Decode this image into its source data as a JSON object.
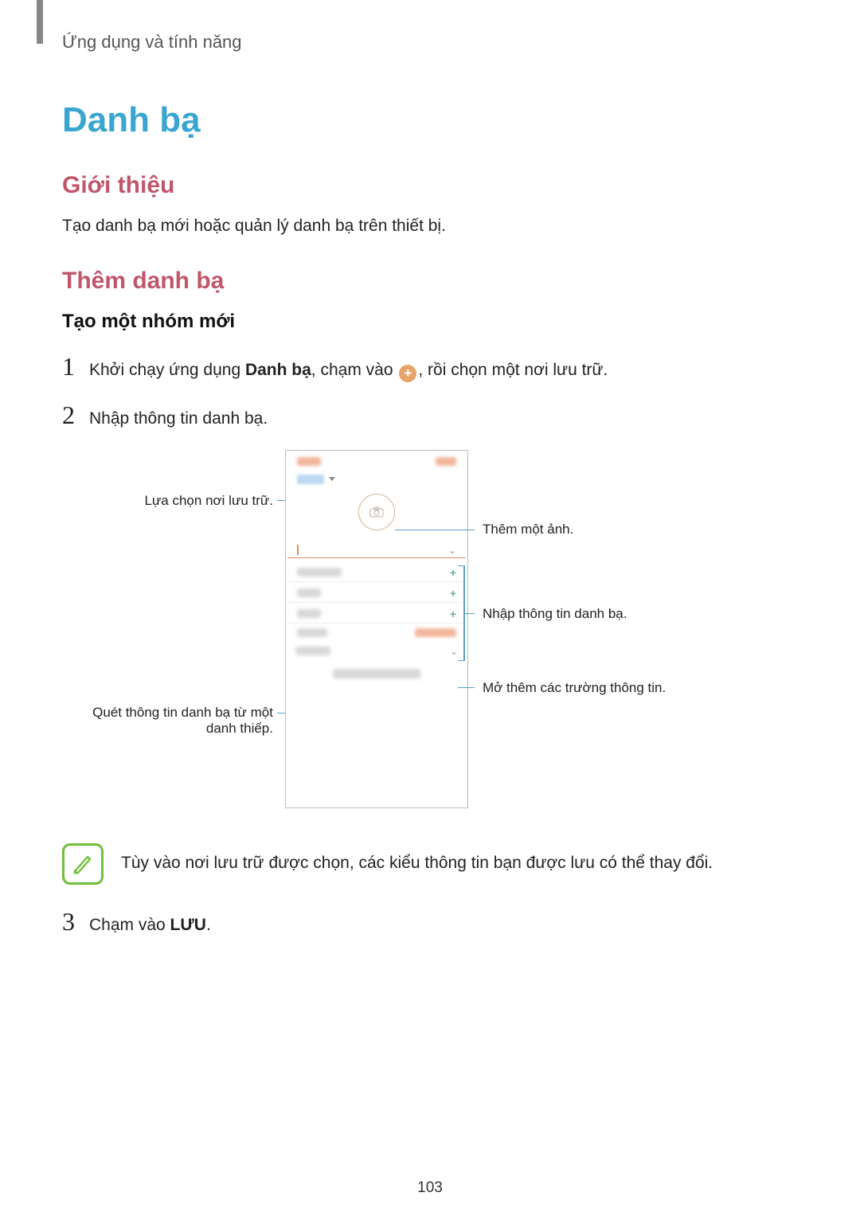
{
  "header": {
    "breadcrumb": "Ứng dụng và tính năng"
  },
  "title": "Danh bạ",
  "sections": {
    "intro": {
      "heading": "Giới thiệu",
      "body": "Tạo danh bạ mới hoặc quản lý danh bạ trên thiết bị."
    },
    "add": {
      "heading": "Thêm danh bạ",
      "sub": "Tạo một nhóm mới"
    }
  },
  "steps": {
    "s1": {
      "num": "1",
      "t1": "Khởi chạy ứng dụng ",
      "b1": "Danh bạ",
      "t2": ", chạm vào ",
      "t3": ", rồi chọn một nơi lưu trữ."
    },
    "s2": {
      "num": "2",
      "t": "Nhập thông tin danh bạ."
    },
    "s3": {
      "num": "3",
      "t1": "Chạm vào ",
      "b1": "LƯU",
      "t2": "."
    }
  },
  "figure": {
    "callouts": {
      "storage": "Lựa chọn nơi lưu trữ.",
      "scan_l1": "Quét thông tin danh bạ từ một",
      "scan_l2": "danh thiếp.",
      "photo": "Thêm một ảnh.",
      "info": "Nhập thông tin danh bạ.",
      "more": "Mở thêm các trường thông tin."
    }
  },
  "note": {
    "text": "Tùy vào nơi lưu trữ được chọn, các kiểu thông tin bạn được lưu có thể thay đổi."
  },
  "page_number": "103",
  "icons": {
    "plus": "+",
    "camera": "◎",
    "chev": "⌄"
  }
}
